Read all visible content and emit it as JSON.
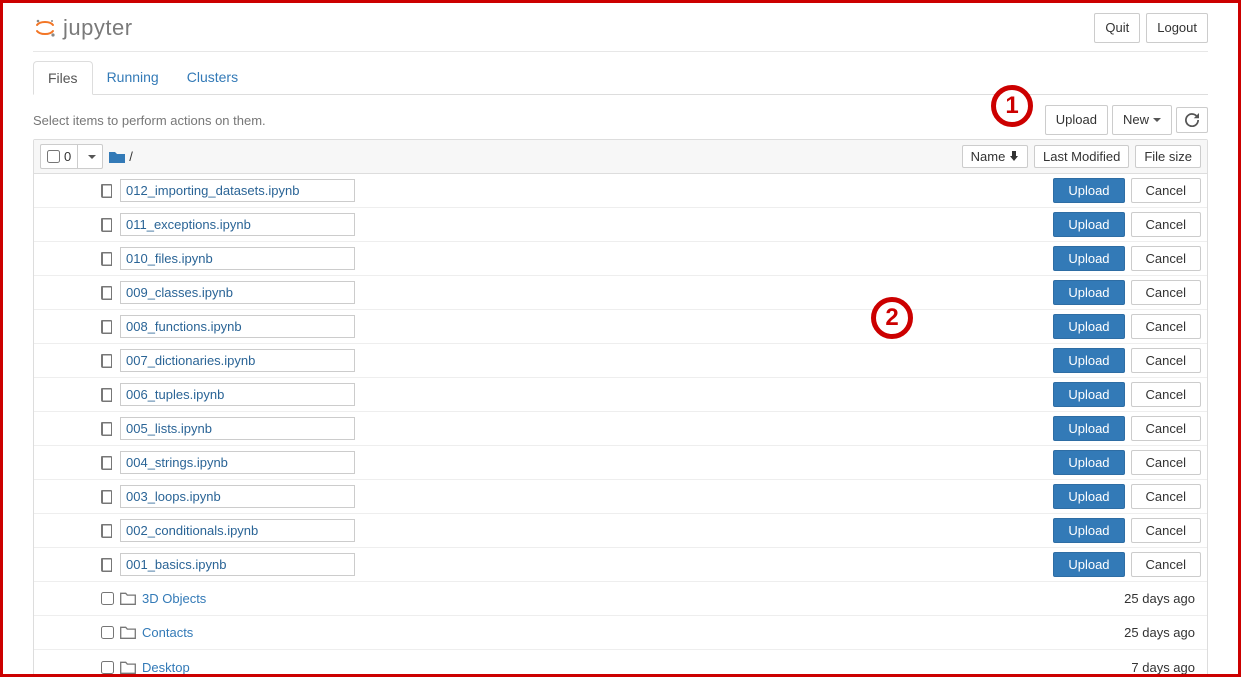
{
  "brand": "jupyter",
  "header": {
    "quit": "Quit",
    "logout": "Logout"
  },
  "tabs": [
    {
      "label": "Files",
      "active": true
    },
    {
      "label": "Running",
      "active": false
    },
    {
      "label": "Clusters",
      "active": false
    }
  ],
  "toolbar": {
    "hint": "Select items to perform actions on them.",
    "upload": "Upload",
    "new": "New"
  },
  "listHeader": {
    "selectedCount": "0",
    "breadcrumb_sep": "/",
    "sortName": "Name",
    "sortModified": "Last Modified",
    "sortSize": "File size"
  },
  "rowButtons": {
    "upload": "Upload",
    "cancel": "Cancel"
  },
  "pending": [
    {
      "name": "012_importing_datasets.ipynb"
    },
    {
      "name": "011_exceptions.ipynb"
    },
    {
      "name": "010_files.ipynb"
    },
    {
      "name": "009_classes.ipynb"
    },
    {
      "name": "008_functions.ipynb"
    },
    {
      "name": "007_dictionaries.ipynb"
    },
    {
      "name": "006_tuples.ipynb"
    },
    {
      "name": "005_lists.ipynb"
    },
    {
      "name": "004_strings.ipynb"
    },
    {
      "name": "003_loops.ipynb"
    },
    {
      "name": "002_conditionals.ipynb"
    },
    {
      "name": "001_basics.ipynb"
    }
  ],
  "folders": [
    {
      "name": "3D Objects",
      "modified": "25 days ago"
    },
    {
      "name": "Contacts",
      "modified": "25 days ago"
    },
    {
      "name": "Desktop",
      "modified": "7 days ago"
    }
  ],
  "callouts": {
    "one": "1",
    "two": "2"
  }
}
